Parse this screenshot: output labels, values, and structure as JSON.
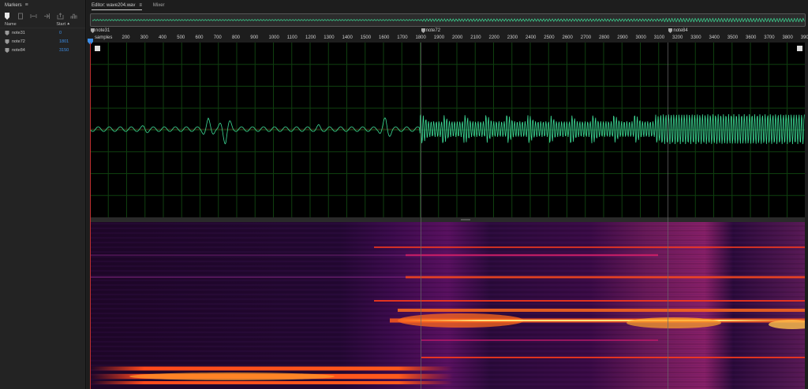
{
  "markers_panel": {
    "title": "Markers",
    "columns": {
      "name": "Name",
      "start": "Start"
    },
    "items": [
      {
        "name": "note31",
        "start": "0"
      },
      {
        "name": "note72",
        "start": "1801"
      },
      {
        "name": "note84",
        "start": "3150"
      }
    ]
  },
  "editor": {
    "tabs": [
      {
        "label": "Editor: wave204.wav",
        "active": true
      },
      {
        "label": "Mixer",
        "active": false
      }
    ],
    "ruler": {
      "unit_label": "samples",
      "ticks": [
        "200",
        "300",
        "400",
        "500",
        "600",
        "700",
        "800",
        "900",
        "1000",
        "1100",
        "1200",
        "1300",
        "1400",
        "1500",
        "1600",
        "1700",
        "1800",
        "1900",
        "2000",
        "2100",
        "2200",
        "2300",
        "2400",
        "2500",
        "2600",
        "2700",
        "2800",
        "2900",
        "3000",
        "3100",
        "3200",
        "3300",
        "3400",
        "3500",
        "3600",
        "3700",
        "3800",
        "3900"
      ]
    },
    "markers": [
      {
        "label": "note31",
        "sample": 0
      },
      {
        "label": "note72",
        "sample": 1801
      },
      {
        "label": "note84",
        "sample": 3150
      }
    ]
  },
  "colors": {
    "waveform": "#3ddc97",
    "waveform_grid": "#0f3f0f",
    "marker_link": "#3d8fe8"
  },
  "icons": [
    "marker-icon",
    "menu-icon",
    "filter-icon"
  ]
}
